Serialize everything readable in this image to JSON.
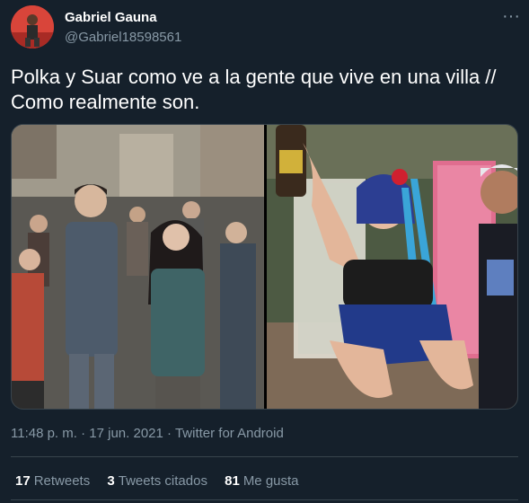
{
  "author": {
    "display_name": "Gabriel Gauna",
    "handle": "@Gabriel18598561",
    "avatar_icon": "profile-photo"
  },
  "more_label": "···",
  "tweet": {
    "text": "Polka y Suar como ve a la gente que vive en una villa // Como realmente son."
  },
  "media": {
    "photos": [
      "left-photo-group-of-people",
      "right-photo-woman-with-bottle"
    ]
  },
  "meta": {
    "time": "11:48 p. m.",
    "separator": "·",
    "date": "17 jun. 2021",
    "source": "Twitter for Android"
  },
  "stats": {
    "retweets_count": "17",
    "retweets_label": "Retweets",
    "quotes_count": "3",
    "quotes_label": "Tweets citados",
    "likes_count": "81",
    "likes_label": "Me gusta"
  },
  "colors": {
    "background": "#15202b",
    "text_primary": "#ffffff",
    "text_secondary": "#8899a6",
    "divider": "#38444d"
  }
}
